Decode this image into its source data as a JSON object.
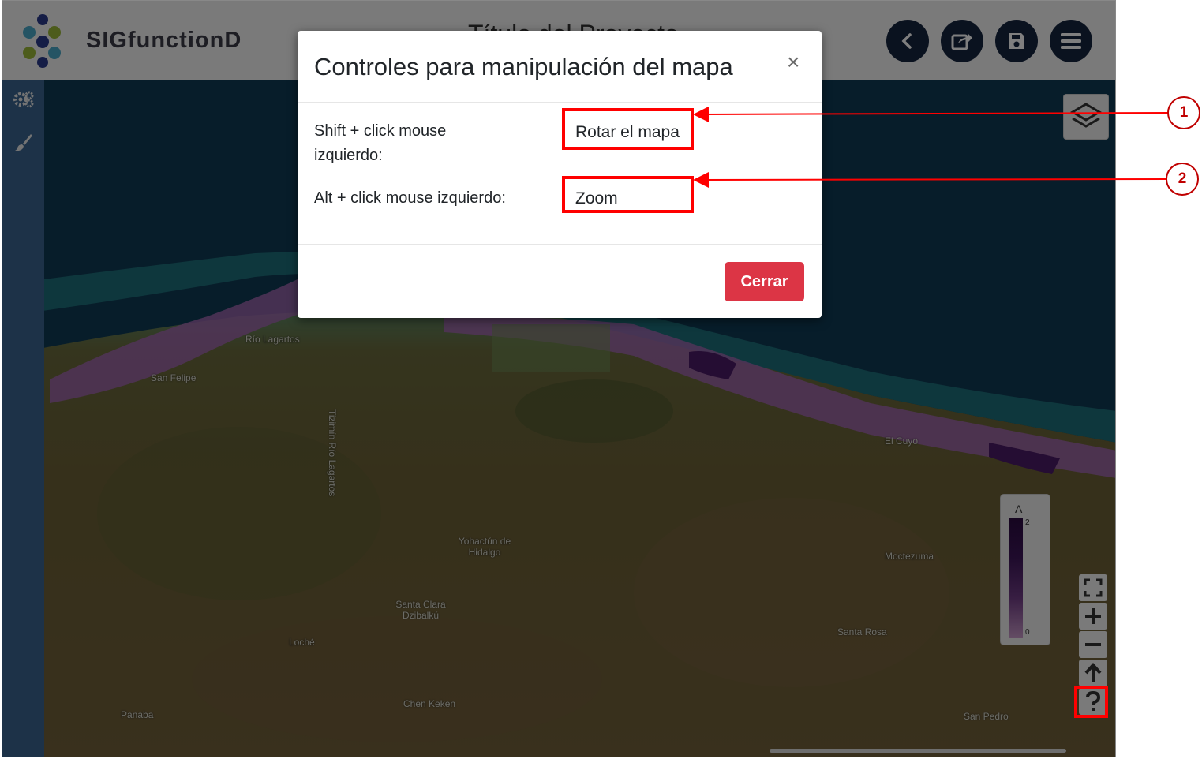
{
  "header": {
    "app_name": "SIGfunctionD",
    "document_title": "Título del Proyecto",
    "buttons": {
      "back_icon": "chevron-left-icon",
      "share_icon": "share-icon",
      "save_icon": "save-icon",
      "menu_icon": "hamburger-menu-icon"
    }
  },
  "sidebar": {
    "items": [
      {
        "icon": "gears-icon"
      },
      {
        "icon": "paintbrush-icon"
      }
    ]
  },
  "map": {
    "places": [
      "Río Lagartos",
      "San Felipe",
      "Tizimín Río Lagartos",
      "El Cuyo",
      "Yohactún de Hidalgo",
      "Moctezuma",
      "Santa Clara Dzibalkú",
      "Santa Rosa",
      "Loché",
      "Chen Keken",
      "Panaba",
      "San Pedro"
    ],
    "legend": {
      "title": "A",
      "max": "2",
      "min": "0"
    },
    "controls": [
      "fullscreen-icon",
      "zoom-in-icon",
      "zoom-out-icon",
      "north-arrow-icon",
      "help-icon"
    ]
  },
  "modal": {
    "title": "Controles para manipulación del mapa",
    "close_symbol": "×",
    "rows": [
      {
        "label": "Shift + click mouse izquierdo:",
        "value": "Rotar el mapa"
      },
      {
        "label": "Alt + click mouse izquierdo:",
        "value": "Zoom"
      }
    ],
    "close_button": "Cerrar"
  },
  "annotations": {
    "callouts": [
      "1",
      "2"
    ],
    "color": "#ff0000"
  },
  "colors": {
    "header_button": "#15243f",
    "sidebar": "#3a6590",
    "close_button": "#dc3545"
  }
}
